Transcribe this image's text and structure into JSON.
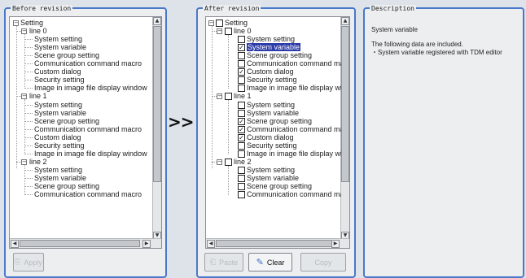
{
  "before": {
    "title": "Before revision",
    "root": "Setting",
    "lines": [
      {
        "label": "line 0",
        "items": [
          "System setting",
          "System variable",
          "Scene group setting",
          "Communication command macro",
          "Custom dialog",
          "Security setting",
          "Image in image file display window"
        ]
      },
      {
        "label": "line 1",
        "items": [
          "System setting",
          "System variable",
          "Scene group setting",
          "Communication command macro",
          "Custom dialog",
          "Security setting",
          "Image in image file display window"
        ]
      },
      {
        "label": "line 2",
        "items": [
          "System setting",
          "System variable",
          "Scene group setting",
          "Communication command macro"
        ]
      }
    ],
    "buttons": {
      "apply_label": "Apply"
    }
  },
  "arrow": ">>",
  "after": {
    "title": "After revision",
    "root": "Setting",
    "lines": [
      {
        "label": "line 0",
        "items": [
          {
            "text": "System setting",
            "checked": false
          },
          {
            "text": "System variable",
            "checked": true,
            "selected": true
          },
          {
            "text": "Scene group setting",
            "checked": false
          },
          {
            "text": "Communication command macro",
            "checked": false
          },
          {
            "text": "Custom dialog",
            "checked": true
          },
          {
            "text": "Security setting",
            "checked": false
          },
          {
            "text": "Image in image file display window",
            "checked": false
          }
        ]
      },
      {
        "label": "line 1",
        "items": [
          {
            "text": "System setting",
            "checked": false
          },
          {
            "text": "System variable",
            "checked": false
          },
          {
            "text": "Scene group setting",
            "checked": true
          },
          {
            "text": "Communication command macro",
            "checked": true
          },
          {
            "text": "Custom dialog",
            "checked": true
          },
          {
            "text": "Security setting",
            "checked": false
          },
          {
            "text": "Image in image file display window",
            "checked": false
          }
        ]
      },
      {
        "label": "line 2",
        "items": [
          {
            "text": "System setting",
            "checked": false
          },
          {
            "text": "System variable",
            "checked": false
          },
          {
            "text": "Scene group setting",
            "checked": false
          },
          {
            "text": "Communication command macro",
            "checked": false
          }
        ]
      }
    ],
    "buttons": {
      "paste_label": "Paste",
      "clear_label": "Clear",
      "copy_label": "Copy"
    }
  },
  "description": {
    "title": "Description",
    "heading": "System variable",
    "line1": "The following data are included.",
    "line2": "・System variable registered with TDM editor"
  }
}
